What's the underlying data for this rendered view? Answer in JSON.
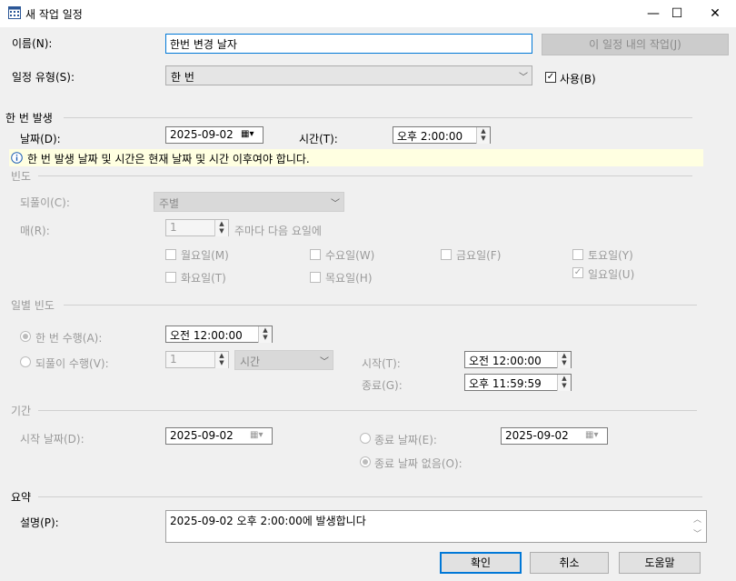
{
  "window": {
    "title": "새 작업 일정",
    "min": "—",
    "max": "☐",
    "close": "✕"
  },
  "name": {
    "label": "이름(N):",
    "value": "한번 변경 날자",
    "jobs_button": "이 일정 내의 작업(J)"
  },
  "schedule_type": {
    "label": "일정 유형(S):",
    "value": "한 번",
    "enabled_label": "사용(B)",
    "enabled_checked": true
  },
  "one_time": {
    "section": "한 번 발생",
    "date_label": "날짜(D):",
    "date_value": "2025-09-02",
    "time_label": "시간(T):",
    "time_value": "오후  2:00:00",
    "info": "한 번 발생 날짜 및 시간은 현재 날짜 및 시간 이후여야 합니다."
  },
  "frequency": {
    "section": "빈도",
    "recur_label": "되풀이(C):",
    "recur_value": "주별",
    "every_label": "매(R):",
    "every_value": "1",
    "every_suffix": "주마다 다음 요일에",
    "days": {
      "mon": "월요일(M)",
      "wed": "수요일(W)",
      "fri": "금요일(F)",
      "sat": "토요일(Y)",
      "tue": "화요일(T)",
      "thu": "목요일(H)",
      "sun": "일요일(U)"
    }
  },
  "daily": {
    "section": "일별 빈도",
    "once_label": "한 번 수행(A):",
    "once_value": "오전 12:00:00",
    "recur_label": "되풀이 수행(V):",
    "recur_num": "1",
    "recur_unit": "시간",
    "start_label": "시작(T):",
    "start_value": "오전 12:00:00",
    "end_label": "종료(G):",
    "end_value": "오후 11:59:59"
  },
  "duration": {
    "section": "기간",
    "start_label": "시작 날짜(D):",
    "start_value": "2025-09-02",
    "end_label": "종료 날짜(E):",
    "end_value": "2025-09-02",
    "noend_label": "종료 날짜 없음(O):"
  },
  "summary": {
    "section": "요약",
    "desc_label": "설명(P):",
    "desc_value": "2025-09-02 오후 2:00:00에 발생합니다"
  },
  "buttons": {
    "ok": "확인",
    "cancel": "취소",
    "help": "도움말"
  }
}
